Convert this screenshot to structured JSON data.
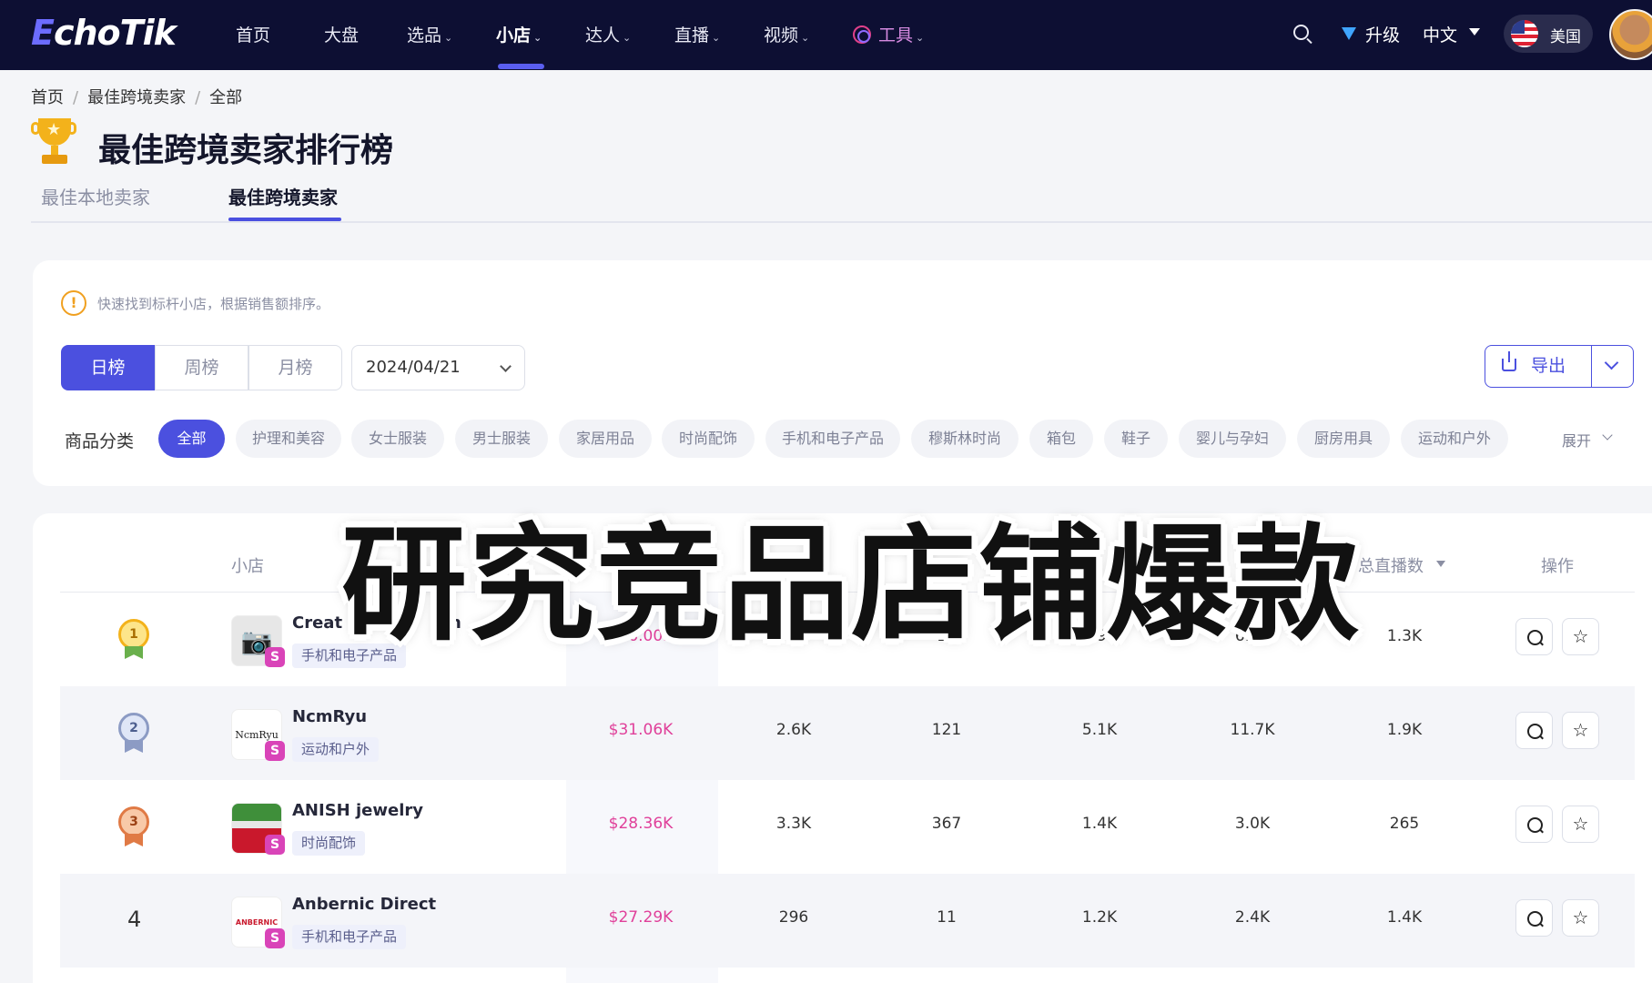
{
  "nav": {
    "logo_e": "E",
    "logo_rest": "choTik",
    "items": [
      {
        "label": "首页"
      },
      {
        "label": "大盘"
      },
      {
        "label": "选品"
      },
      {
        "label": "小店"
      },
      {
        "label": "达人"
      },
      {
        "label": "直播"
      },
      {
        "label": "视频"
      },
      {
        "label": "工具"
      }
    ],
    "upgrade": "升级",
    "language": "中文",
    "region": "美国"
  },
  "breadcrumb": [
    "首页",
    "最佳跨境卖家",
    "全部"
  ],
  "page_title": "最佳跨境卖家排行榜",
  "tabs": [
    {
      "label": "最佳本地卖家"
    },
    {
      "label": "最佳跨境卖家"
    }
  ],
  "filter": {
    "tip": "快速找到标杆小店，根据销售额排序。",
    "periods": [
      "日榜",
      "周榜",
      "月榜"
    ],
    "date": "2024/04/21",
    "export": "导出",
    "category_label": "商品分类",
    "categories": [
      "全部",
      "护理和美容",
      "女士服装",
      "男士服装",
      "家居用品",
      "时尚配饰",
      "手机和电子产品",
      "穆斯林时尚",
      "箱包",
      "鞋子",
      "婴儿与孕妇",
      "厨房用具",
      "运动和户外"
    ],
    "expand": "展开"
  },
  "table": {
    "columns": {
      "shop": "小店",
      "live_count": "总直播数",
      "actions": "操作"
    },
    "rows": [
      {
        "rank": "1",
        "name": "Creat",
        "name_tail": "h",
        "category": "手机和电子产品",
        "sales": "$36.00K",
        "c1": "964",
        "c2": "15",
        "c3": "3.9K",
        "c4": "6.6K",
        "c5": "1.3K"
      },
      {
        "rank": "2",
        "name": "NcmRyu",
        "logo_text": "NcmRyu",
        "category": "运动和户外",
        "sales": "$31.06K",
        "c1": "2.6K",
        "c2": "121",
        "c3": "5.1K",
        "c4": "11.7K",
        "c5": "1.9K"
      },
      {
        "rank": "3",
        "name": "ANISH jewelry",
        "category": "时尚配饰",
        "sales": "$28.36K",
        "c1": "3.3K",
        "c2": "367",
        "c3": "1.4K",
        "c4": "3.0K",
        "c5": "265"
      },
      {
        "rank": "4",
        "name": "Anbernic Direct",
        "logo_text": "ANBERNIC",
        "category": "手机和电子产品",
        "sales": "$27.29K",
        "c1": "296",
        "c2": "11",
        "c3": "1.2K",
        "c4": "2.4K",
        "c5": "1.4K"
      }
    ],
    "badge_letter": "S"
  },
  "overlay_caption": "研究竞品店铺爆款",
  "colors": {
    "nav_bg": "#0d0f33",
    "accent": "#4b50df",
    "sales": "#e0409a",
    "badge": "#d944b8",
    "gold": "#f3b21b",
    "silver": "#8c9bc4",
    "bronze": "#e07a45"
  }
}
